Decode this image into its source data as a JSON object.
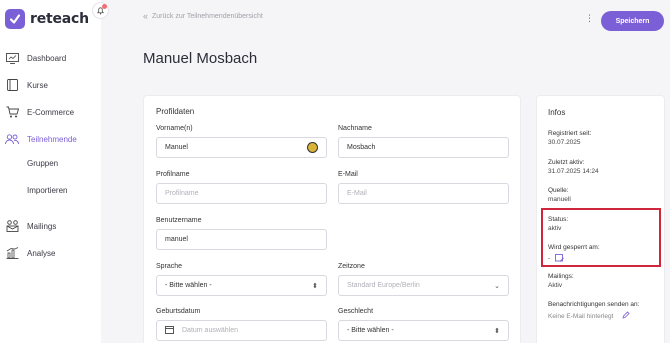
{
  "app": {
    "logo_text": "reteach"
  },
  "sidebar": {
    "items": [
      {
        "label": "Dashboard",
        "icon": "dashboard-icon"
      },
      {
        "label": "Kurse",
        "icon": "book-icon"
      },
      {
        "label": "E-Commerce",
        "icon": "cart-icon"
      },
      {
        "label": "Teilnehmende",
        "icon": "users-icon",
        "active": true
      },
      {
        "label": "Mailings",
        "icon": "mail-users-icon"
      },
      {
        "label": "Analyse",
        "icon": "chart-icon"
      }
    ],
    "sub_items": [
      "Gruppen",
      "Importieren"
    ]
  },
  "header": {
    "back_label": "Zurück zur Teilnehmendenübersicht",
    "save_label": "Speichern",
    "title": "Manuel Mosbach"
  },
  "profile": {
    "section_title": "Profildaten",
    "vorname_label": "Vorname(n)",
    "vorname_value": "Manuel",
    "nachname_label": "Nachname",
    "nachname_value": "Mosbach",
    "profilname_label": "Profilname",
    "profilname_placeholder": "Profilname",
    "email_label": "E-Mail",
    "email_placeholder": "E-Mail",
    "benutzername_label": "Benutzername",
    "benutzername_value": "manuel",
    "sprache_label": "Sprache",
    "sprache_value": "- Bitte wählen -",
    "zeitzone_label": "Zeitzone",
    "zeitzone_value": "Standard Europe/Berlin",
    "geburtsdatum_label": "Geburtsdatum",
    "geburtsdatum_placeholder": "Datum auswählen",
    "geschlecht_label": "Geschlecht",
    "geschlecht_value": "- Bitte wählen -"
  },
  "infos": {
    "title": "Infos",
    "registriert_label": "Registriert seit:",
    "registriert_value": "30.07.2025",
    "aktiv_label": "Zuletzt aktiv:",
    "aktiv_value": "31.07.2025 14:24",
    "quelle_label": "Quelle:",
    "quelle_value": "manuell",
    "status_label": "Status:",
    "status_value": "aktiv",
    "gesperrt_label": "Wird gesperrt am:",
    "gesperrt_value": "-",
    "mailings_label": "Mailings:",
    "mailings_value": "Aktiv",
    "benachrichtigung_label": "Benachrichtigungen senden an:",
    "benachrichtigung_value": "Keine E-Mail hinterlegt"
  },
  "colors": {
    "accent": "#7b5fd6",
    "highlight": "#d0263b"
  }
}
